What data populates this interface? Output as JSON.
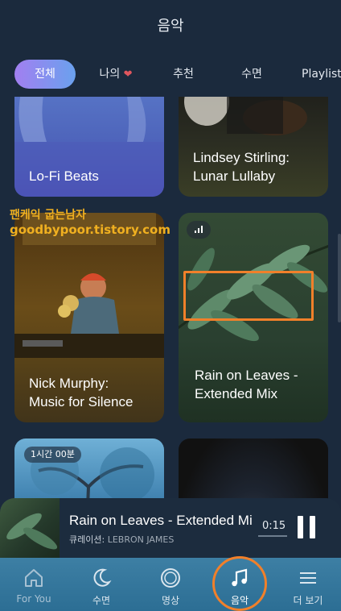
{
  "header": {
    "title": "음악"
  },
  "tabs": [
    {
      "label": "전체",
      "active": true
    },
    {
      "label": "나의",
      "heart": "❤"
    },
    {
      "label": "추천"
    },
    {
      "label": "수면"
    },
    {
      "label": "Playlists"
    }
  ],
  "cards": [
    {
      "title": "Lo-Fi Beats"
    },
    {
      "title": "Lindsey Stirling:\nLunar Lullaby"
    },
    {
      "title": "Nick Murphy:\nMusic for Silence"
    },
    {
      "title": "Rain on Leaves -\nExtended Mix"
    },
    {
      "badge": "1시간 00분"
    },
    {}
  ],
  "watermark": {
    "line1": "팬케익 굽는남자",
    "line2": "goodbypoor.tistory.com"
  },
  "player": {
    "title": "Rain on Leaves - Extended Mi",
    "curator_label": "큐레이션:",
    "curator_name": "LEBRON JAMES",
    "time": "0:15"
  },
  "nav": [
    {
      "label": "For You",
      "icon": "home-icon"
    },
    {
      "label": "수면",
      "icon": "moon-icon"
    },
    {
      "label": "명상",
      "icon": "meditation-circle-icon"
    },
    {
      "label": "음악",
      "icon": "music-note-icon",
      "active": true
    },
    {
      "label": "더 보기",
      "icon": "menu-icon"
    }
  ],
  "colors": {
    "background": "#1b2a3d",
    "tab_gradient_start": "#a27ff0",
    "tab_gradient_end": "#6aa1ee",
    "highlight": "#f1802a",
    "nav_background": "#3d7fa4",
    "watermark": "#f0b020"
  }
}
